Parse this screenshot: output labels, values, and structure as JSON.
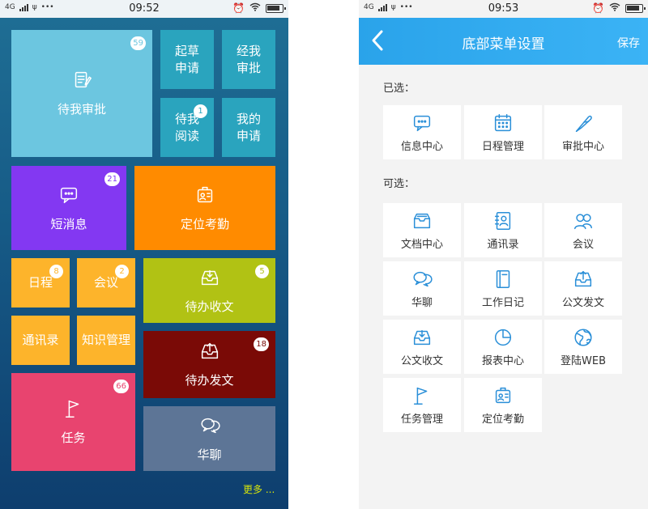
{
  "statusbar": {
    "network": "4G",
    "left_time": "09:52",
    "right_time": "09:53"
  },
  "home": {
    "tiles": [
      {
        "label": "待我审批",
        "badge": "59",
        "color": "#6cc6e0"
      },
      {
        "label": "起草\n申请",
        "badge": "",
        "color": "#2aa4be"
      },
      {
        "label": "经我\n审批",
        "badge": "",
        "color": "#2aa4be"
      },
      {
        "label": "待我\n阅读",
        "badge": "1",
        "color": "#2aa4be"
      },
      {
        "label": "我的\n申请",
        "badge": "",
        "color": "#2aa4be"
      },
      {
        "label": "短消息",
        "badge": "21",
        "color": "#8338f2"
      },
      {
        "label": "定位考勤",
        "badge": "",
        "color": "#ff8b00"
      },
      {
        "label": "日程",
        "badge": "8",
        "color": "#fdb42b"
      },
      {
        "label": "会议",
        "badge": "2",
        "color": "#fdb42b"
      },
      {
        "label": "通讯录",
        "badge": "",
        "color": "#fdb42b"
      },
      {
        "label": "知识管理",
        "badge": "",
        "color": "#fdb42b"
      },
      {
        "label": "待办收文",
        "badge": "5",
        "color": "#b1c214"
      },
      {
        "label": "待办发文",
        "badge": "18",
        "color": "#7a0a06"
      },
      {
        "label": "任务",
        "badge": "66",
        "color": "#e8446f"
      },
      {
        "label": "华聊",
        "badge": "",
        "color": "#5d7596"
      }
    ],
    "more_label": "更多 ..."
  },
  "settings": {
    "title": "底部菜单设置",
    "save_label": "保存",
    "selected_label": "已选：",
    "available_label": "可选：",
    "selected": [
      {
        "label": "信息中心"
      },
      {
        "label": "日程管理"
      },
      {
        "label": "审批中心"
      }
    ],
    "available": [
      {
        "label": "文档中心"
      },
      {
        "label": "通讯录"
      },
      {
        "label": "会议"
      },
      {
        "label": "华聊"
      },
      {
        "label": "工作日记"
      },
      {
        "label": "公文发文"
      },
      {
        "label": "公文收文"
      },
      {
        "label": "报表中心"
      },
      {
        "label": "登陆WEB"
      },
      {
        "label": "任务管理"
      },
      {
        "label": "定位考勤"
      }
    ],
    "icon_color": "#2a8fd8"
  }
}
